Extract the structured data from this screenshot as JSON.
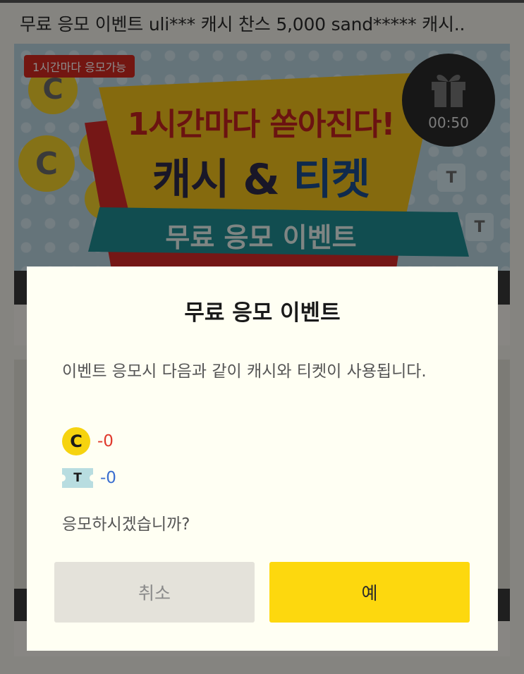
{
  "ticker": {
    "text": "무료 응모 이벤트 uli***  캐시 찬스 5,000 sand*****  캐시.."
  },
  "banner": {
    "badge": "1시간마다 응모가능",
    "headline": "1시간마다 쏟아진다!",
    "main_left": "캐시",
    "main_amp": "&",
    "main_right": "티켓",
    "ribbon": "무료 응모 이벤트",
    "timer": "00:50",
    "coin_glyph": "C",
    "ticket_glyph": "T"
  },
  "dialog": {
    "title": "무료 응모 이벤트",
    "message": "이벤트 응모시 다음과 같이 캐시와 티켓이 사용됩니다.",
    "cash_icon": "C",
    "cash_cost": "-0",
    "ticket_icon": "T",
    "ticket_cost": "-0",
    "question": "응모하시겠습니까?",
    "cancel_label": "취소",
    "confirm_label": "예"
  },
  "colors": {
    "confirm_bg": "#fdd80e",
    "cancel_bg": "#e4e2da",
    "cash_cost": "#e0392c",
    "ticket_cost": "#3b6fd0",
    "badge_bg": "#d12820"
  },
  "icons": {
    "gift": "gift-icon",
    "coin": "coin-icon",
    "ticket": "ticket-icon"
  }
}
